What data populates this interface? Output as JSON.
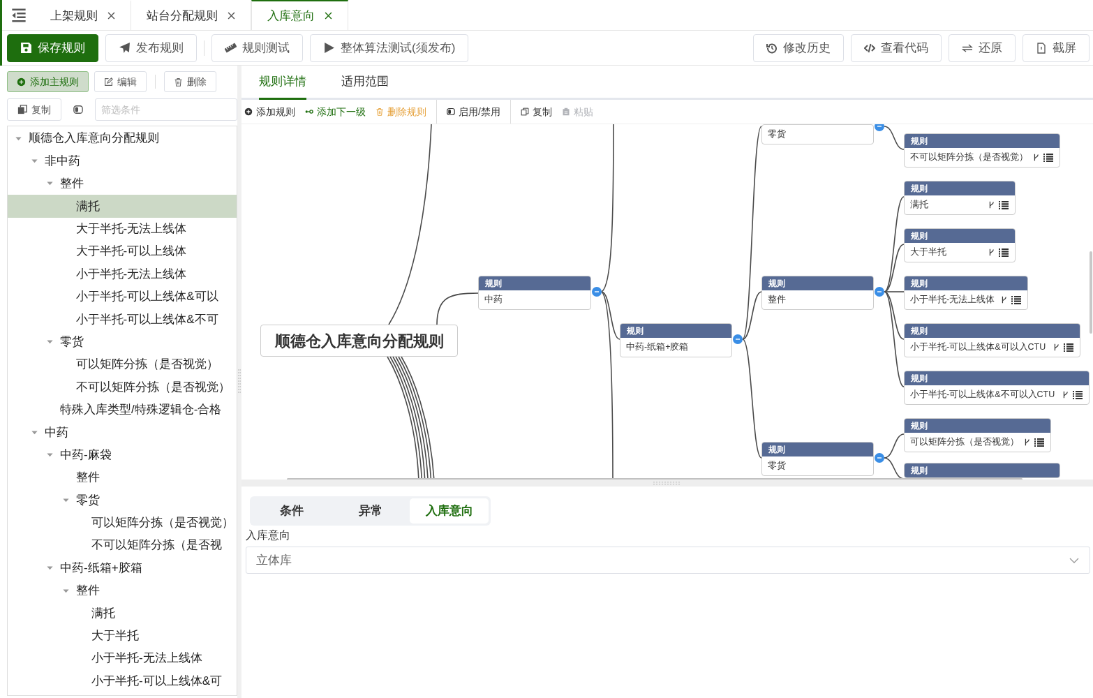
{
  "tabs": [
    {
      "label": "上架规则",
      "selected": false
    },
    {
      "label": "站台分配规则",
      "selected": false
    },
    {
      "label": "入库意向",
      "selected": true
    }
  ],
  "toolbar": {
    "left_groups": [
      [
        {
          "label": "保存规则",
          "primary": true
        },
        {
          "label": "发布规则",
          "primary": false
        }
      ],
      [
        {
          "label": "规则测试",
          "primary": false
        },
        {
          "label": "整体算法测试(须发布)",
          "primary": false
        }
      ]
    ],
    "right": [
      {
        "label": "修改历史"
      },
      {
        "label": "查看代码"
      },
      {
        "label": "还原"
      },
      {
        "label": "截屏"
      }
    ]
  },
  "left_panel": {
    "action_groups": [
      [
        {
          "label": "添加主规则",
          "primary": true
        },
        {
          "label": "编辑",
          "primary": false
        }
      ],
      [
        {
          "label": "删除",
          "primary": false
        }
      ]
    ],
    "copy_button": "复制",
    "filter": {
      "placeholder": "筛选条件"
    },
    "tree": [
      {
        "label": "顺德仓入库意向分配规则",
        "selected": false,
        "expanded": true,
        "children": [
          {
            "label": "非中药",
            "selected": false,
            "expanded": true,
            "children": [
              {
                "label": "整件",
                "selected": false,
                "expanded": true,
                "children": [
                  {
                    "label": "满托",
                    "selected": true
                  },
                  {
                    "label": "大于半托-无法上线体",
                    "selected": false
                  },
                  {
                    "label": "大于半托-可以上线体",
                    "selected": false
                  },
                  {
                    "label": "小于半托-无法上线体",
                    "selected": false
                  },
                  {
                    "label": "小于半托-可以上线体&可以",
                    "selected": false
                  },
                  {
                    "label": "小于半托-可以上线体&不可",
                    "selected": false
                  }
                ]
              },
              {
                "label": "零货",
                "selected": false,
                "expanded": true,
                "children": [
                  {
                    "label": "可以矩阵分拣（是否视觉）",
                    "selected": false
                  },
                  {
                    "label": "不可以矩阵分拣（是否视觉）",
                    "selected": false
                  }
                ]
              },
              {
                "label": "特殊入库类型/特殊逻辑仓-合格",
                "selected": false
              }
            ]
          },
          {
            "label": "中药",
            "selected": false,
            "expanded": true,
            "children": [
              {
                "label": "中药-麻袋",
                "selected": false,
                "expanded": true,
                "children": [
                  {
                    "label": "整件",
                    "selected": false
                  },
                  {
                    "label": "零货",
                    "selected": false,
                    "expanded": true,
                    "children": [
                      {
                        "label": "可以矩阵分拣（是否视觉）",
                        "selected": false
                      },
                      {
                        "label": "不可以矩阵分拣（是否视",
                        "selected": false
                      }
                    ]
                  }
                ]
              },
              {
                "label": "中药-纸箱+胶箱",
                "selected": false,
                "expanded": true,
                "children": [
                  {
                    "label": "整件",
                    "selected": false,
                    "expanded": true,
                    "children": [
                      {
                        "label": "满托",
                        "selected": false
                      },
                      {
                        "label": "大于半托",
                        "selected": false
                      },
                      {
                        "label": "小于半托-无法上线体",
                        "selected": false
                      },
                      {
                        "label": "小于半托-可以上线体&可",
                        "selected": false
                      }
                    ]
                  }
                ]
              }
            ]
          }
        ]
      }
    ]
  },
  "right_tabs": [
    {
      "label": "规则详情",
      "selected": true
    },
    {
      "label": "适用范围",
      "selected": false
    }
  ],
  "action_groups": [
    [
      {
        "label": "添加规则",
        "color": "#333333",
        "disabled": false
      },
      {
        "label": "添加下一级",
        "color": "#1e6e0e",
        "disabled": false
      },
      {
        "label": "删除规则",
        "color": "#e6a23c",
        "disabled": false
      }
    ],
    [
      {
        "label": "启用/禁用",
        "color": "#333333",
        "disabled": false
      }
    ],
    [
      {
        "label": "复制",
        "color": "#333333",
        "disabled": false
      },
      {
        "label": "粘贴",
        "disabled": true
      }
    ]
  ],
  "canvas": {
    "root": {
      "kind": "root",
      "label": "顺德仓入库意向分配规则",
      "children": [
        {
          "kind": "branch",
          "header": "规则",
          "label": "中药",
          "expanded": true,
          "children": [
            {
              "kind": "branch",
              "header": "规则",
              "label": "中药-纸箱+胶箱",
              "expanded": true,
              "children": [
                {
                  "kind": "branch",
                  "label": "零货",
                  "expanded": true,
                  "children": [
                    {
                      "kind": "leaf",
                      "header": "规则",
                      "label": "不可以矩阵分拣（是否视觉）"
                    }
                  ]
                },
                {
                  "kind": "branch",
                  "header": "规则",
                  "label": "整件",
                  "expanded": true,
                  "children": [
                    {
                      "kind": "leaf",
                      "header": "规则",
                      "label": "满托"
                    },
                    {
                      "kind": "leaf",
                      "header": "规则",
                      "label": "大于半托"
                    },
                    {
                      "kind": "leaf",
                      "header": "规则",
                      "label": "小于半托-无法上线体"
                    },
                    {
                      "kind": "leaf",
                      "header": "规则",
                      "label": "小于半托-可以上线体&可以入CTU"
                    },
                    {
                      "kind": "leaf",
                      "header": "规则",
                      "label": "小于半托-可以上线体&不可以入CTU"
                    }
                  ]
                },
                {
                  "kind": "branch",
                  "header": "规则",
                  "label": "零货",
                  "expanded": true,
                  "children": [
                    {
                      "kind": "leaf",
                      "header": "规则",
                      "label": "可以矩阵分拣（是否视觉）"
                    },
                    {
                      "kind": "leaf",
                      "header": "规则"
                    }
                  ]
                }
              ]
            }
          ]
        }
      ]
    }
  },
  "detail": {
    "tabs": [
      {
        "label": "条件",
        "selected": false
      },
      {
        "label": "异常",
        "selected": false
      },
      {
        "label": "入库意向",
        "selected": true
      }
    ],
    "field_label": "入库意向",
    "select": {
      "value": "立体库"
    }
  }
}
